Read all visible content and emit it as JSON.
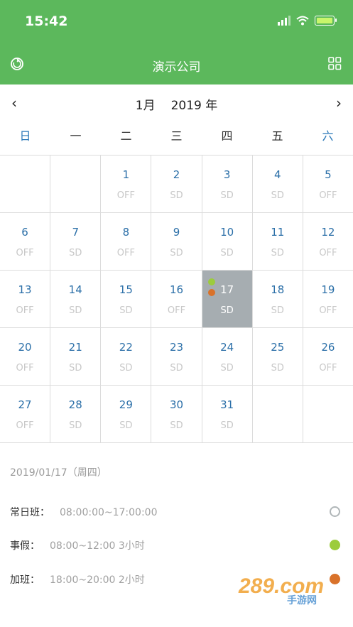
{
  "status": {
    "time": "15:42"
  },
  "app": {
    "title": "演示公司"
  },
  "nav": {
    "month": "1月",
    "year": "2019 年",
    "prev": "‹",
    "next": "›"
  },
  "weekdays": [
    "日",
    "一",
    "二",
    "三",
    "四",
    "五",
    "六"
  ],
  "weeks": [
    [
      {
        "d": "",
        "s": ""
      },
      {
        "d": "",
        "s": ""
      },
      {
        "d": "1",
        "s": "OFF"
      },
      {
        "d": "2",
        "s": "SD"
      },
      {
        "d": "3",
        "s": "SD"
      },
      {
        "d": "4",
        "s": "SD"
      },
      {
        "d": "5",
        "s": "OFF"
      }
    ],
    [
      {
        "d": "6",
        "s": "OFF"
      },
      {
        "d": "7",
        "s": "SD"
      },
      {
        "d": "8",
        "s": "OFF"
      },
      {
        "d": "9",
        "s": "SD"
      },
      {
        "d": "10",
        "s": "SD"
      },
      {
        "d": "11",
        "s": "SD"
      },
      {
        "d": "12",
        "s": "OFF"
      }
    ],
    [
      {
        "d": "13",
        "s": "OFF"
      },
      {
        "d": "14",
        "s": "SD"
      },
      {
        "d": "15",
        "s": "SD"
      },
      {
        "d": "16",
        "s": "OFF"
      },
      {
        "d": "17",
        "s": "SD"
      },
      {
        "d": "18",
        "s": "SD"
      },
      {
        "d": "19",
        "s": "OFF"
      }
    ],
    [
      {
        "d": "20",
        "s": "OFF"
      },
      {
        "d": "21",
        "s": "SD"
      },
      {
        "d": "22",
        "s": "SD"
      },
      {
        "d": "23",
        "s": "SD"
      },
      {
        "d": "24",
        "s": "SD"
      },
      {
        "d": "25",
        "s": "SD"
      },
      {
        "d": "26",
        "s": "OFF"
      }
    ],
    [
      {
        "d": "27",
        "s": "OFF"
      },
      {
        "d": "28",
        "s": "SD"
      },
      {
        "d": "29",
        "s": "SD"
      },
      {
        "d": "30",
        "s": "SD"
      },
      {
        "d": "31",
        "s": "SD"
      },
      {
        "d": "",
        "s": ""
      },
      {
        "d": "",
        "s": ""
      }
    ]
  ],
  "selected_day": "17",
  "detail": {
    "date": "2019/01/17（周四）",
    "items": [
      {
        "label": "常日班：",
        "value": "08:00:00~17:00:00",
        "color": "#b0b6b8",
        "style": "outline"
      },
      {
        "label": "事假：",
        "value": "08:00~12:00 3小时",
        "color": "#9ccc3c",
        "style": "filled"
      },
      {
        "label": "加班：",
        "value": "18:00~20:00 2小时",
        "color": "#d9722a",
        "style": "filled"
      }
    ]
  },
  "colors": {
    "header": "#5cb85c",
    "weekend": "#2b78b8",
    "day": "#2b6fa8",
    "selected": "#a6adb1",
    "dot_green": "#9ccc3c",
    "dot_orange": "#d9722a"
  },
  "watermark": {
    "text": "289.com",
    "sub": "手游网"
  }
}
